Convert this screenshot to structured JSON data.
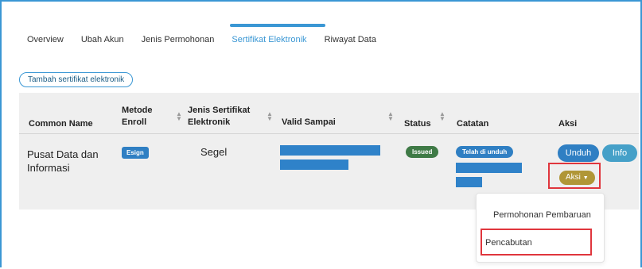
{
  "tabs": [
    {
      "label": "Overview"
    },
    {
      "label": "Ubah Akun"
    },
    {
      "label": "Jenis Permohonan"
    },
    {
      "label": "Sertifikat Elektronik"
    },
    {
      "label": "Riwayat Data"
    }
  ],
  "active_tab": "Sertifikat Elektronik",
  "add_button": "Tambah sertifikat elektronik",
  "table": {
    "headers": {
      "common_name": "Common Name",
      "metode_enroll_1": "Metode",
      "metode_enroll_2": "Enroll",
      "jenis_1": "Jenis Sertifikat",
      "jenis_2": "Elektronik",
      "valid_sampai": "Valid Sampai",
      "status": "Status",
      "catatan": "Catatan",
      "aksi": "Aksi"
    },
    "row": {
      "common_name_1": "Pusat Data dan",
      "common_name_2": "Informasi",
      "metode_enroll": "Esign",
      "jenis": "Segel",
      "status": "Issued",
      "catatan": "Telah di unduh"
    }
  },
  "actions": {
    "unduh": "Unduh",
    "info": "Info",
    "aksi": "Aksi"
  },
  "dropdown": {
    "items": [
      "Permohonan Pembaruan",
      "Pencabutan"
    ]
  },
  "colors": {
    "accent": "#3a97d4",
    "highlight": "#e0363d",
    "aksi": "#b09636",
    "issued": "#3f7a46",
    "redaction": "#2f82c9"
  }
}
